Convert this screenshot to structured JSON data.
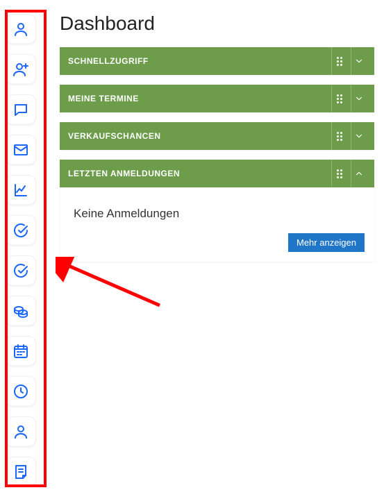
{
  "page_title": "Dashboard",
  "sidebar": {
    "items": [
      {
        "icon": "person-icon"
      },
      {
        "icon": "person-plus-icon"
      },
      {
        "icon": "chat-icon"
      },
      {
        "icon": "mail-icon"
      },
      {
        "icon": "chart-line-icon"
      },
      {
        "icon": "check-circle-icon"
      },
      {
        "icon": "check-circle-icon"
      },
      {
        "icon": "coins-icon"
      },
      {
        "icon": "calendar-icon"
      },
      {
        "icon": "clock-icon"
      },
      {
        "icon": "person-icon"
      },
      {
        "icon": "note-icon"
      }
    ]
  },
  "panels": [
    {
      "title": "SCHNELLZUGRIFF",
      "expanded": false
    },
    {
      "title": "MEINE TERMINE",
      "expanded": false
    },
    {
      "title": "VERKAUFSCHANCEN",
      "expanded": false
    },
    {
      "title": "LETZTEN ANMELDUNGEN",
      "expanded": true,
      "empty_msg": "Keine Anmeldungen",
      "more_label": "Mehr anzeigen"
    }
  ],
  "annotation": {
    "type": "red-rect-and-arrow",
    "target": "sidebar"
  }
}
